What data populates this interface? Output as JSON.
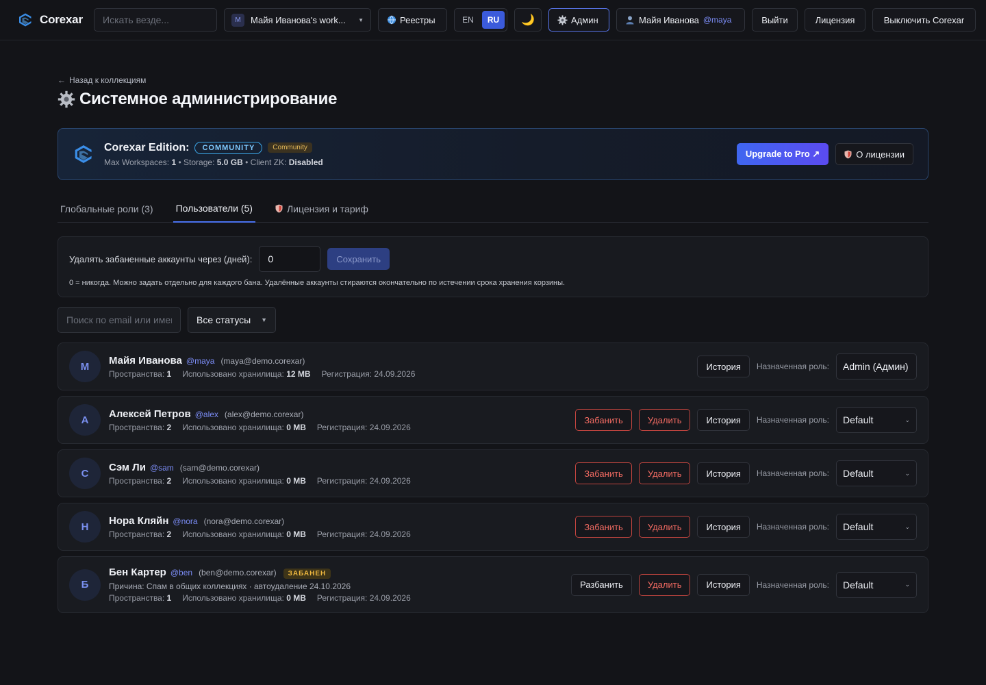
{
  "header": {
    "brand": "Corexar",
    "search_placeholder": "Искать везде...",
    "workspace": {
      "letter": "M",
      "name": "Майя Иванова's work..."
    },
    "registries": "Реестры",
    "lang": {
      "en": "EN",
      "ru": "RU",
      "active": "RU"
    },
    "theme_icon": "🌙",
    "admin": "Админ",
    "user": {
      "name": "Майя Иванова",
      "handle": "@maya"
    },
    "logout": "Выйти",
    "license": "Лицензия",
    "disable": "Выключить Corexar"
  },
  "page": {
    "back": "Назад к коллекциям",
    "title": "Системное администрирование"
  },
  "edition": {
    "title": "Corexar Edition:",
    "badge": "COMMUNITY",
    "tier": "Community",
    "max_ws_label": "Max Workspaces:",
    "max_ws": "1",
    "storage_label": "Storage:",
    "storage": "5.0 GB",
    "zk_label": "Client ZK:",
    "zk": "Disabled",
    "upgrade": "Upgrade to Pro ↗",
    "about": "О лицензии"
  },
  "tabs": [
    {
      "label": "Глобальные роли (3)",
      "active": false
    },
    {
      "label": "Пользователи (5)",
      "active": true
    },
    {
      "label": "Лицензия и тариф",
      "active": false
    }
  ],
  "settings": {
    "label": "Удалять забаненные аккаунты через (дней):",
    "value": "0",
    "save": "Сохранить",
    "hint": "0 = никогда. Можно задать отдельно для каждого бана. Удалённые аккаунты стираются окончательно по истечении срока хранения корзины."
  },
  "filters": {
    "search_placeholder": "Поиск по email или имени",
    "status": "Все статусы"
  },
  "labels": {
    "spaces": "Пространства:",
    "storage": "Использовано хранилища:",
    "registered": "Регистрация:",
    "ban": "Забанить",
    "unban": "Разбанить",
    "delete": "Удалить",
    "history": "История",
    "assigned_role": "Назначенная роль:"
  },
  "users": [
    {
      "initial": "М",
      "name": "Майя Иванова",
      "handle": "@maya",
      "email": "(maya@demo.corexar)",
      "spaces": "1",
      "storage": "12 MB",
      "registered": "24.09.2026",
      "role": "Admin (Админ)",
      "is_self": true,
      "banned": false
    },
    {
      "initial": "A",
      "name": "Алексей Петров",
      "handle": "@alex",
      "email": "(alex@demo.corexar)",
      "spaces": "2",
      "storage": "0 MB",
      "registered": "24.09.2026",
      "role": "Default",
      "is_self": false,
      "banned": false
    },
    {
      "initial": "С",
      "name": "Сэм Ли",
      "handle": "@sam",
      "email": "(sam@demo.corexar)",
      "spaces": "2",
      "storage": "0 MB",
      "registered": "24.09.2026",
      "role": "Default",
      "is_self": false,
      "banned": false
    },
    {
      "initial": "Н",
      "name": "Нора Кляйн",
      "handle": "@nora",
      "email": "(nora@demo.corexar)",
      "spaces": "2",
      "storage": "0 MB",
      "registered": "24.09.2026",
      "role": "Default",
      "is_self": false,
      "banned": false
    },
    {
      "initial": "Б",
      "name": "Бен Картер",
      "handle": "@ben",
      "email": "(ben@demo.corexar)",
      "spaces": "1",
      "storage": "0 MB",
      "registered": "24.09.2026",
      "role": "Default",
      "is_self": false,
      "banned": true,
      "ban_badge": "ЗАБАНЕН",
      "ban_reason": "Причина: Спам в общих коллекциях · автоудаление 24.10.2026"
    }
  ],
  "colors": {
    "accent": "#3b5bdb",
    "danger": "#f26b62",
    "ban_badge": "#f0b83f",
    "edition_border": "#2a4770"
  }
}
